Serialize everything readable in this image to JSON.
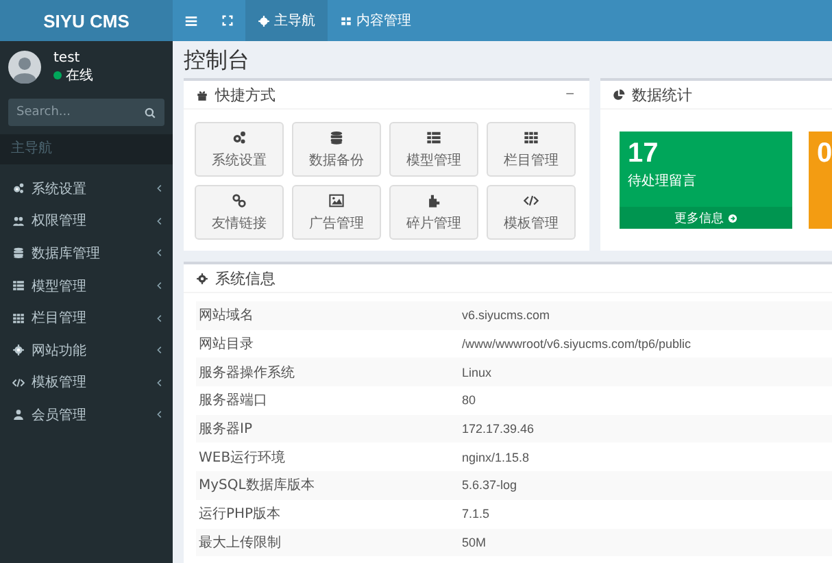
{
  "brand": "SIYU CMS",
  "topnav": [
    {
      "label": "主导航",
      "selected": true
    },
    {
      "label": "内容管理",
      "selected": false
    }
  ],
  "user": {
    "name": "test",
    "status": "在线",
    "online": true
  },
  "search": {
    "placeholder": "Search..."
  },
  "sidebar": {
    "header": "主导航",
    "items": [
      {
        "label": "系统设置"
      },
      {
        "label": "权限管理"
      },
      {
        "label": "数据库管理"
      },
      {
        "label": "模型管理"
      },
      {
        "label": "栏目管理"
      },
      {
        "label": "网站功能"
      },
      {
        "label": "模板管理"
      },
      {
        "label": "会员管理"
      }
    ]
  },
  "page_title": "控制台",
  "shortcuts": {
    "title": "快捷方式",
    "collapse": "−",
    "items": [
      {
        "label": "系统设置"
      },
      {
        "label": "数据备份"
      },
      {
        "label": "模型管理"
      },
      {
        "label": "栏目管理"
      },
      {
        "label": "友情链接"
      },
      {
        "label": "广告管理"
      },
      {
        "label": "碎片管理"
      },
      {
        "label": "模板管理"
      }
    ]
  },
  "stats": {
    "title": "数据统计",
    "cards": [
      {
        "value": "17",
        "label": "待处理留言",
        "link": "更多信息",
        "color": "#00a65a"
      },
      {
        "value": "0",
        "color": "#f39c12"
      }
    ]
  },
  "system_info": {
    "title": "系统信息",
    "rows": [
      {
        "name": "网站域名",
        "value": "v6.siyucms.com"
      },
      {
        "name": "网站目录",
        "value": "/www/wwwroot/v6.siyucms.com/tp6/public"
      },
      {
        "name": "服务器操作系统",
        "value": "Linux"
      },
      {
        "name": "服务器端口",
        "value": "80"
      },
      {
        "name": "服务器IP",
        "value": "172.17.39.46"
      },
      {
        "name": "WEB运行环境",
        "value": "nginx/1.15.8"
      },
      {
        "name": "MySQL数据库版本",
        "value": "5.6.37-log"
      },
      {
        "name": "运行PHP版本",
        "value": "7.1.5"
      },
      {
        "name": "最大上传限制",
        "value": "50M"
      }
    ]
  }
}
